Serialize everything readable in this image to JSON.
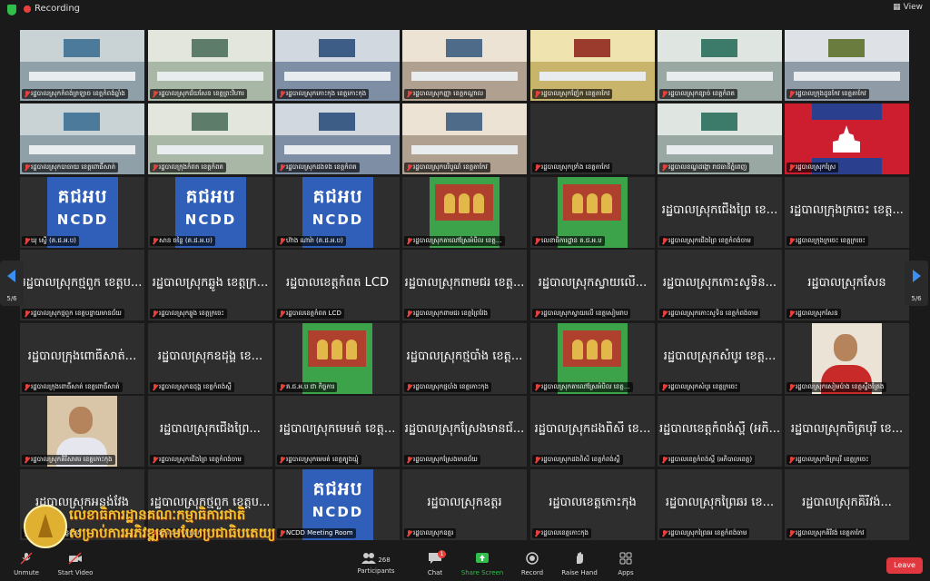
{
  "topbar": {
    "recording_label": "Recording",
    "view_label": "View"
  },
  "pager": {
    "left": "5/6",
    "right": "5/6"
  },
  "toolbar": {
    "unmute": "Unmute",
    "start_video": "Start Video",
    "participants": "Participants",
    "participants_count": "268",
    "chat": "Chat",
    "chat_badge": "1",
    "share_screen": "Share Screen",
    "record": "Record",
    "raise_hand": "Raise Hand",
    "apps": "Apps",
    "leave": "Leave"
  },
  "colors": {
    "accent_green": "#2fbf4a",
    "leave_red": "#e0383e",
    "ncdd_blue": "#2f5fb8"
  },
  "tiles": [
    {
      "kind": "room",
      "label": "រដ្ឋបាលស្រុកកំពង់ត្រឡាច ខេត្តកំពង់ឆ្នាំង"
    },
    {
      "kind": "room",
      "label": "រដ្ឋបាលស្រុកជ័យសែន ខេត្តព្រះវិហារ"
    },
    {
      "kind": "room",
      "label": "រដ្ឋបាលស្រុកកោះកុង ខេត្តកោះកុង"
    },
    {
      "kind": "room",
      "label": "រដ្ឋបាលស្រុកញ្ញា ខេត្តកណ្ដាល"
    },
    {
      "kind": "room",
      "label": "រដ្ឋបាលស្រុកញ៉ែក ខេត្តតាកែវ"
    },
    {
      "kind": "room",
      "label": "រដ្ឋបាលស្រុកខ្សាច់ ខេត្តកំពត"
    },
    {
      "kind": "room",
      "label": "រដ្ឋបាលក្រុងដូនកែវ ខេត្តតាកែវ"
    },
    {
      "kind": "room",
      "label": "រដ្ឋបាលស្រុកបាធាយ ខេត្តពោធិ៍សាត់"
    },
    {
      "kind": "room",
      "label": "រដ្ឋបាលក្រុងកំពត ខេត្តកំពត"
    },
    {
      "kind": "room",
      "label": "រដ្ឋបាលស្រុកដងទង ខេត្តកំពត"
    },
    {
      "kind": "room",
      "label": "រដ្ឋបាលស្រុកបរិបូណ៌ ខេត្តតាកែវ"
    },
    {
      "kind": "blank",
      "label": "រដ្ឋបាលស្រុកទ្រាំង ខេត្តតាកែវ"
    },
    {
      "kind": "room",
      "label": "រដ្ឋបាលខណ្ឌដង្កោ រាជធានីភ្នំពេញ"
    },
    {
      "kind": "flag",
      "label": "រដ្ឋបាលស្រុកស្រែ"
    },
    {
      "kind": "ncdd",
      "label": "ឃុ ស្ទើ (គ.ជ.អ.ប)"
    },
    {
      "kind": "ncdd",
      "label": "សាន ចន្ថៃ (គ.ជ.អ.ប)"
    },
    {
      "kind": "ncdd",
      "label": "ហ៊ាង ណារ៉ា (គ.ជ.អ.ប)"
    },
    {
      "kind": "banner",
      "label": "រដ្ឋបាលស្រុកតាលៅស្រែអំបិល ខេត្ត..."
    },
    {
      "kind": "banner",
      "label": "លេខាធិការដ្ឋាន គ.ជ.អ.ប"
    },
    {
      "kind": "text",
      "name": "រដ្ឋបាលស្រុកជើងព្រៃ ខេ...",
      "label": "រដ្ឋបាលស្រុកជើងព្រៃ ខេត្តកំពង់ចាម"
    },
    {
      "kind": "text",
      "name": "រដ្ឋបាលក្រុងក្រចេះ ខេត្ត...",
      "label": "រដ្ឋបាលក្រុងក្រចេះ ខេត្តក្រចេះ"
    },
    {
      "kind": "text",
      "name": "រដ្ឋបាលស្រុកថ្មពួក ខេត្តប...",
      "label": "រដ្ឋបាលស្រុកថ្មពួក ខេត្តបន្ទាយមានជ័យ"
    },
    {
      "kind": "text",
      "name": "រដ្ឋបាលស្រុកឆ្លូង ខេត្តក្រ...",
      "label": "រដ្ឋបាលស្រុកឆ្លូង ខេត្តក្រចេះ"
    },
    {
      "kind": "text",
      "name": "រដ្ឋបាលខេត្តកំពត LCD",
      "label": "រដ្ឋបាលខេត្តកំពត LCD"
    },
    {
      "kind": "text",
      "name": "រដ្ឋបាលស្រុកពាមជរ ខេត្ត...",
      "label": "រដ្ឋបាលស្រុកពាមជរ ខេត្តព្រៃវែង"
    },
    {
      "kind": "text",
      "name": "រដ្ឋបាលស្រុកស្វាយលើ...",
      "label": "រដ្ឋបាលស្រុកស្វាយលើ ខេត្តសៀមរាប"
    },
    {
      "kind": "text",
      "name": "រដ្ឋបាលស្រុកកោះសូទិន...",
      "label": "រដ្ឋបាលស្រុកកោះសូទិន ខេត្តកំពង់ចាម"
    },
    {
      "kind": "text",
      "name": "រដ្ឋបាលស្រុកសែន",
      "label": "រដ្ឋបាលស្រុកសែន"
    },
    {
      "kind": "text",
      "name": "រដ្ឋបាលក្រុងពោធិ៍សាត់...",
      "label": "រដ្ឋបាលក្រុងពោធិ៍សាត់ ខេត្តពោធិ៍សាត់"
    },
    {
      "kind": "text",
      "name": "រដ្ឋបាលស្រុកឧដុង្គ ខេ...",
      "label": "រដ្ឋបាលស្រុកឧដុង្គ ខេត្តកំពង់ស្ពឺ"
    },
    {
      "kind": "banner",
      "label": "គ.ជ.អ.ប ជា កិច្ចការ"
    },
    {
      "kind": "text",
      "name": "រដ្ឋបាលស្រុកថ្មបាំង ខេត្ត...",
      "label": "រដ្ឋបាលស្រុកថ្មបាំង ខេត្តកោះកុង"
    },
    {
      "kind": "banner",
      "label": "រដ្ឋបាលស្រុកតាលៅស្រែអំបិល ខេត្ត..."
    },
    {
      "kind": "text",
      "name": "រដ្ឋបាលស្រុកសំបូរ ខេត្ត...",
      "label": "រដ្ឋបាលស្រុកសំបូរ ខេត្តក្រចេះ"
    },
    {
      "kind": "person-red",
      "label": "រដ្ឋបាលស្រុកសៀមប៉ាង ខេត្តស្ទឹងត្រែង"
    },
    {
      "kind": "person",
      "label": "រដ្ឋបាលស្រុកគិរីសាគរ ខេត្តកោះកុង"
    },
    {
      "kind": "text",
      "name": "រដ្ឋបាលស្រុកជើងព្រៃ...",
      "label": "រដ្ឋបាលស្រុកជើងព្រៃ ខេត្តកំពង់ចាម"
    },
    {
      "kind": "text",
      "name": "រដ្ឋបាលស្រុកមេមត់ ខេត្ត...",
      "label": "រដ្ឋបាលស្រុកមេមត់ ខេត្តត្បូងឃ្មុំ"
    },
    {
      "kind": "text",
      "name": "រដ្ឋបាលស្រុកស្រែងមានជ័...",
      "label": "រដ្ឋបាលស្រុកស្រែងមានជ័យ"
    },
    {
      "kind": "text",
      "name": "រដ្ឋបាលស្រុកដងពិសី ខេ...",
      "label": "រដ្ឋបាលស្រុកដងពិសី ខេត្តកំពង់ស្ពឺ"
    },
    {
      "kind": "text",
      "name": "រដ្ឋបាលខេត្តកំពង់ស្ពឺ (អភិ...",
      "label": "រដ្ឋបាលខេត្តកំពង់ស្ពឺ (អភិបាលខេត្ត)"
    },
    {
      "kind": "text",
      "name": "រដ្ឋបាលស្រុកចិត្របុរី ខេ...",
      "label": "រដ្ឋបាលស្រុកចិត្របុរី ខេត្តក្រចេះ"
    },
    {
      "kind": "text",
      "name": "រដ្ឋបាលស្រុកអន្លង់វែង",
      "label": "រដ្ឋបាលស្រុកអន្លង់វែង"
    },
    {
      "kind": "text",
      "name": "រដ្ឋបាលស្រុកថ្មពួក ខេត្តប...",
      "label": "រដ្ឋបាលស្រុកថ្មពួក"
    },
    {
      "kind": "ncdd",
      "label": "NCDD Meeting Room"
    },
    {
      "kind": "text",
      "name": "រដ្ឋបាលស្រុកឧត្តរ",
      "label": "រដ្ឋបាលស្រុកឧត្តរ"
    },
    {
      "kind": "text",
      "name": "រដ្ឋបាលខេត្តកោះកុង",
      "label": "រដ្ឋបាលខេត្តកោះកុង"
    },
    {
      "kind": "text",
      "name": "រដ្ឋបាលស្រុកព្រៃឆរ ខេ...",
      "label": "រដ្ឋបាលស្រុកព្រៃឆរ ខេត្តកំពង់ចាម"
    },
    {
      "kind": "text",
      "name": "រដ្ឋបាលស្រុកគិរីវង់...",
      "label": "រដ្ឋបាលស្រុកគិរីវង់ ខេត្តតាកែវ"
    }
  ],
  "ncdd": {
    "kh": "គជអប",
    "en": "NCDD"
  },
  "watermark": {
    "line1": "លេខាធិការដ្ឋានគណៈកម្មាធិការជាតិ",
    "line2": "សម្រាប់ការអភិវឌ្ឍតាមបែបប្រជាធិបតេយ្យ"
  }
}
